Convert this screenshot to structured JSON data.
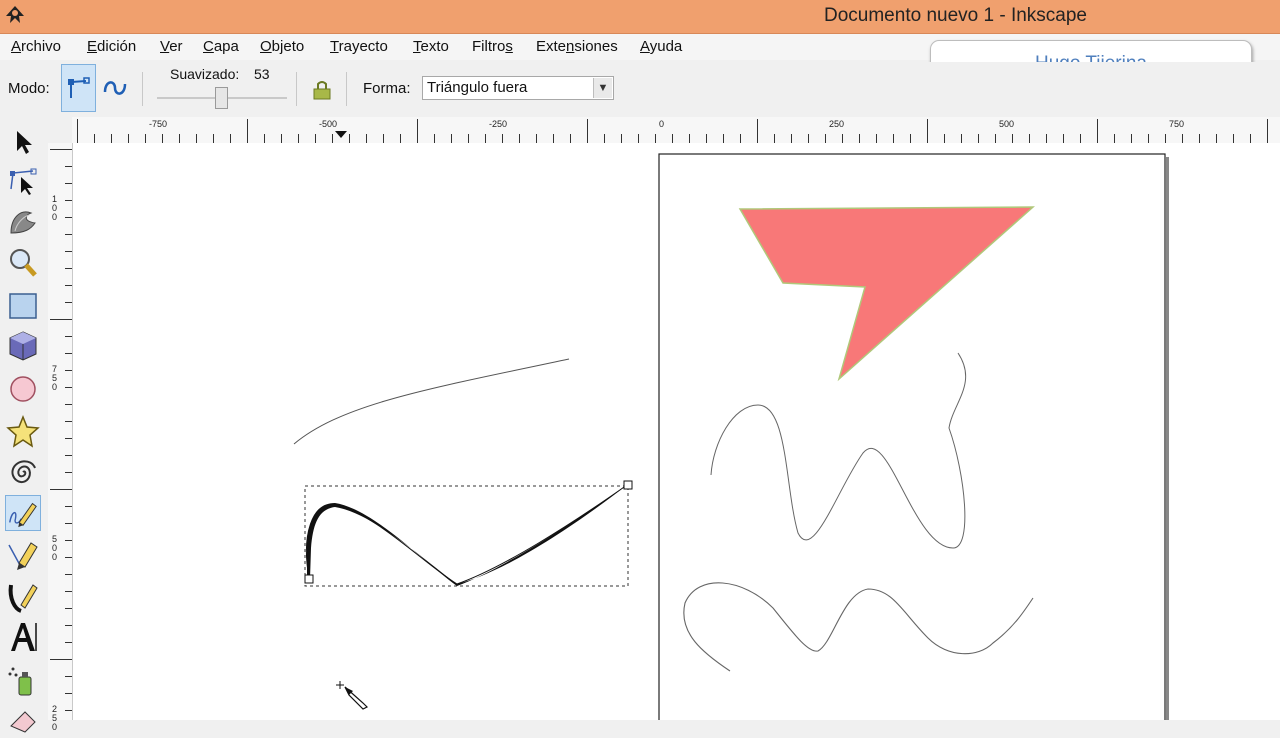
{
  "window": {
    "title": "Documento nuevo 1 - Inkscape"
  },
  "menu": [
    {
      "pre": "",
      "ul": "A",
      "post": "rchivo"
    },
    {
      "pre": "",
      "ul": "E",
      "post": "dición"
    },
    {
      "pre": "",
      "ul": "V",
      "post": "er"
    },
    {
      "pre": "",
      "ul": "C",
      "post": "apa"
    },
    {
      "pre": "",
      "ul": "O",
      "post": "bjeto"
    },
    {
      "pre": "",
      "ul": "T",
      "post": "rayecto"
    },
    {
      "pre": "",
      "ul": "T",
      "post": "exto"
    },
    {
      "pre": "Filtro",
      "ul": "s",
      "post": ""
    },
    {
      "pre": "Exte",
      "ul": "n",
      "post": "siones"
    },
    {
      "pre": "",
      "ul": "A",
      "post": "yuda"
    }
  ],
  "badge": {
    "name": "Hugo Tijerina"
  },
  "tool_controls": {
    "mode_label": "Modo:",
    "smoothing_label": "Suavizado:",
    "smoothing_value": "53",
    "smoothing_level": 0.53,
    "shape_label": "Forma:",
    "shape_value": "Triángulo fuera"
  },
  "rulers": {
    "horizontal": [
      "-750",
      "-500",
      "-250",
      "0",
      "250",
      "500",
      "750"
    ],
    "vertical": [
      "100",
      "750",
      "500",
      "250"
    ]
  },
  "toolbox": {
    "tools": [
      "selector",
      "node",
      "tweak",
      "zoom",
      "rectangle",
      "3d-box",
      "ellipse",
      "star",
      "spiral",
      "pencil",
      "pen",
      "calligraphy",
      "text",
      "spray",
      "eraser"
    ],
    "active": "pencil"
  },
  "colors": {
    "title_bar": "#f0a06e",
    "shape_fill": "#f87878",
    "shape_stroke": "#b0c87a",
    "badge_text": "#4f7fbd",
    "active_tool": "#cfe4f7"
  }
}
